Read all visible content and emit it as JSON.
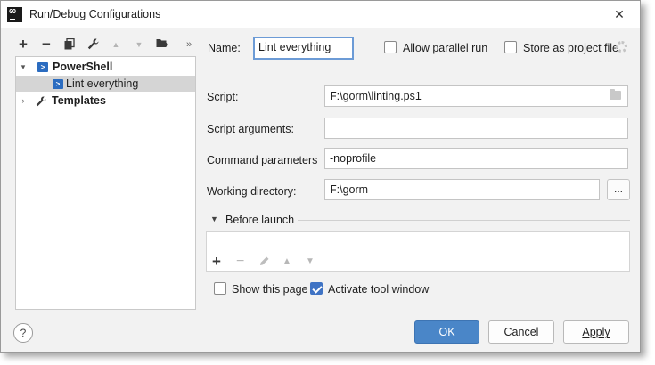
{
  "window": {
    "title": "Run/Debug Configurations",
    "app_icon_text": "GO",
    "close_glyph": "✕"
  },
  "toolbar": {
    "add": "+",
    "remove": "−",
    "up": "▲",
    "down": "▼",
    "more": "»"
  },
  "tree": {
    "items": [
      {
        "label": "PowerShell",
        "icon": "powershell-icon",
        "expanded": true
      },
      {
        "label": "Lint everything",
        "icon": "powershell-icon",
        "selected": true
      },
      {
        "label": "Templates",
        "icon": "wrench-icon",
        "expanded": false
      }
    ]
  },
  "form": {
    "name_label": "Name:",
    "name_value": "Lint everything",
    "allow_parallel_label": "Allow parallel run",
    "allow_parallel_checked": false,
    "store_project_label": "Store as project file",
    "store_project_checked": false,
    "script_label": "Script:",
    "script_value": "F:\\gorm\\linting.ps1",
    "script_args_label": "Script arguments:",
    "script_args_value": "",
    "command_params_label": "Command parameters",
    "command_params_value": "-noprofile",
    "working_dir_label": "Working directory:",
    "working_dir_value": "F:\\gorm",
    "browse_label": "...",
    "before_launch_label": "Before launch",
    "before_launch_tools": {
      "add": "+",
      "remove": "−",
      "up": "▲",
      "down": "▼"
    },
    "show_page_label": "Show this page",
    "show_page_checked": false,
    "activate_tool_label": "Activate tool window",
    "activate_tool_checked": true
  },
  "footer": {
    "help": "?",
    "ok": "OK",
    "cancel": "Cancel",
    "apply": "Apply"
  },
  "colors": {
    "accent": "#4a86c8",
    "selection": "#d5d5d5",
    "focus_border": "#6c9bd6"
  }
}
